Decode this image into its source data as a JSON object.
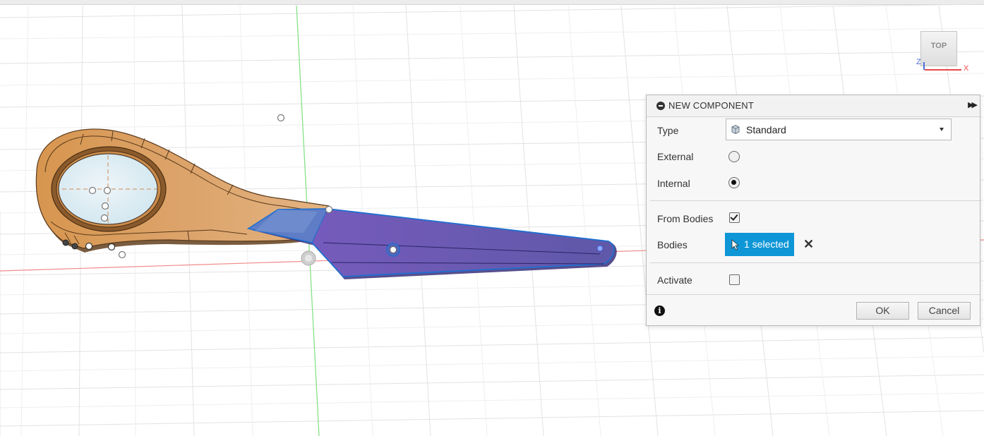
{
  "viewcube": {
    "face_label": "TOP",
    "axis_x": "X",
    "axis_z": "Z"
  },
  "dialog": {
    "title": "NEW COMPONENT",
    "type_label": "Type",
    "type_value": "Standard",
    "external_label": "External",
    "external_selected": false,
    "internal_label": "Internal",
    "internal_selected": true,
    "from_bodies_label": "From Bodies",
    "from_bodies_checked": true,
    "bodies_label": "Bodies",
    "bodies_selection": "1 selected",
    "activate_label": "Activate",
    "activate_checked": false,
    "ok_label": "OK",
    "cancel_label": "Cancel"
  },
  "colors": {
    "handle_body": "#d69a58",
    "selected_body": "#6655b0",
    "selection_accent": "#0e96d7",
    "grid_line": "#e3e3e3",
    "x_axis": "#ee7777",
    "y_axis": "#77dd77"
  }
}
